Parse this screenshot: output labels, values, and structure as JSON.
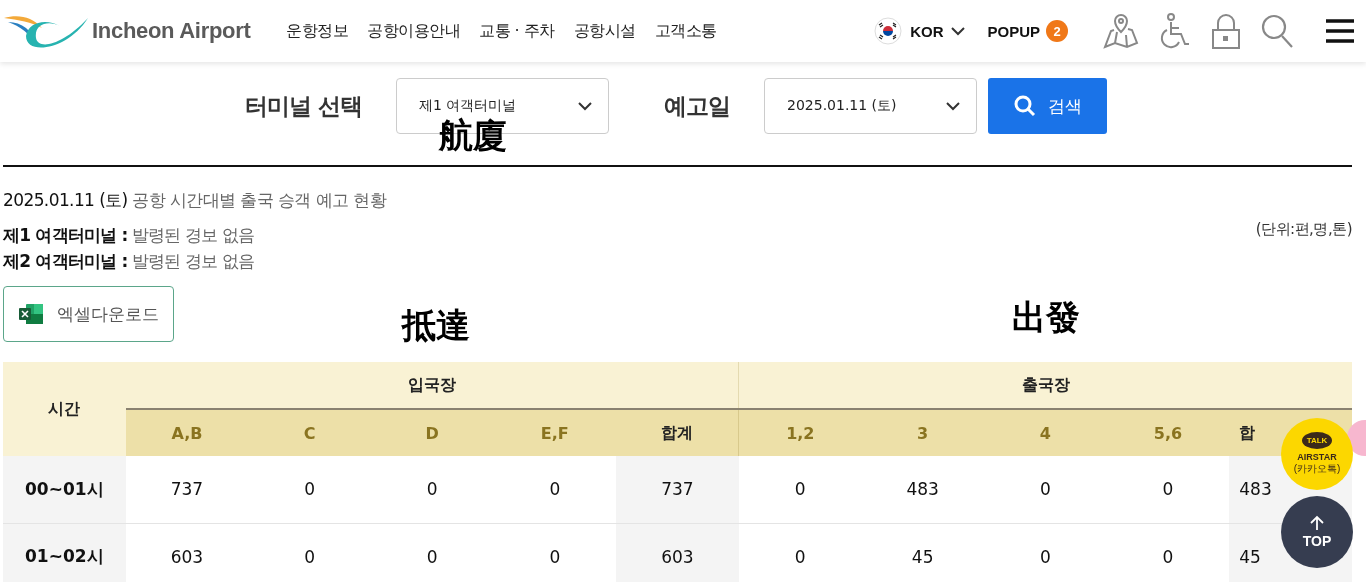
{
  "header": {
    "logo_text": "Incheon Airport",
    "nav": [
      "운항정보",
      "공항이용안내",
      "교통 · 주차",
      "공항시설",
      "고객소통"
    ],
    "language": "KOR",
    "popup": {
      "label": "POPUP",
      "count": "2"
    }
  },
  "search": {
    "terminal_label": "터미널 선택",
    "terminal_value": "제1 여객터미널",
    "date_label": "예고일",
    "date_value": "2025.01.11 (토)",
    "button": "검색"
  },
  "summary": {
    "date": "2025.01.11 (토)",
    "title": "공항 시간대별 출국 승객 예고 현황",
    "unit": "(단위:편,명,톤)",
    "alerts": [
      {
        "terminal": "제1 여객터미널 :",
        "status": "발령된 경보 없음"
      },
      {
        "terminal": "제2 여객터미널 :",
        "status": "발령된 경보 없음"
      }
    ]
  },
  "excel_button": "엑셀다운로드",
  "table": {
    "time_header": "시간",
    "groups": [
      {
        "label": "입국장",
        "columns": [
          "A,B",
          "C",
          "D",
          "E,F",
          "합계"
        ]
      },
      {
        "label": "출국장",
        "columns": [
          "1,2",
          "3",
          "4",
          "5,6",
          "합"
        ]
      }
    ],
    "rows": [
      {
        "time": "00~01시",
        "cells": [
          "737",
          "0",
          "0",
          "0",
          "737",
          "0",
          "483",
          "0",
          "0",
          "483"
        ]
      },
      {
        "time": "01~02시",
        "cells": [
          "603",
          "0",
          "0",
          "0",
          "603",
          "0",
          "45",
          "0",
          "0",
          "45"
        ]
      }
    ]
  },
  "floating": {
    "chat": {
      "badge": "TALK",
      "label": "AIRSTAR",
      "sub": "(카카오톡)"
    },
    "top": "TOP"
  },
  "annotations": [
    "航廈",
    "抵達",
    "出發"
  ]
}
